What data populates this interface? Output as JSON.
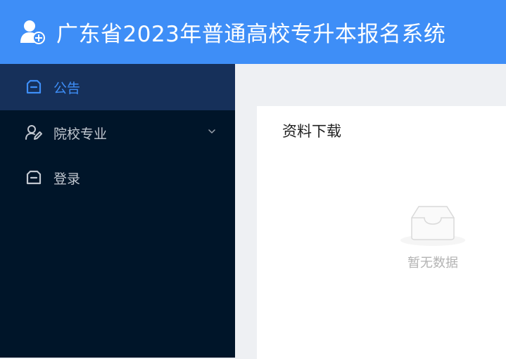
{
  "header": {
    "title": "广东省2023年普通高校专升本报名系统",
    "logo_icon": "user-add-icon",
    "background": "#3e8ef7"
  },
  "sidebar": {
    "background": "#001529",
    "items": [
      {
        "label": "公告",
        "icon": "inbox-icon",
        "active": true
      },
      {
        "label": "院校专业",
        "icon": "user-edit-icon",
        "expandable": true
      },
      {
        "label": "登录",
        "icon": "inbox-icon"
      }
    ]
  },
  "main": {
    "card": {
      "title": "资料下载",
      "empty_text": "暂无数据",
      "empty_icon": "empty-box-icon"
    }
  },
  "colors": {
    "accent": "#3e8ef7",
    "active_bg": "#16305a"
  }
}
